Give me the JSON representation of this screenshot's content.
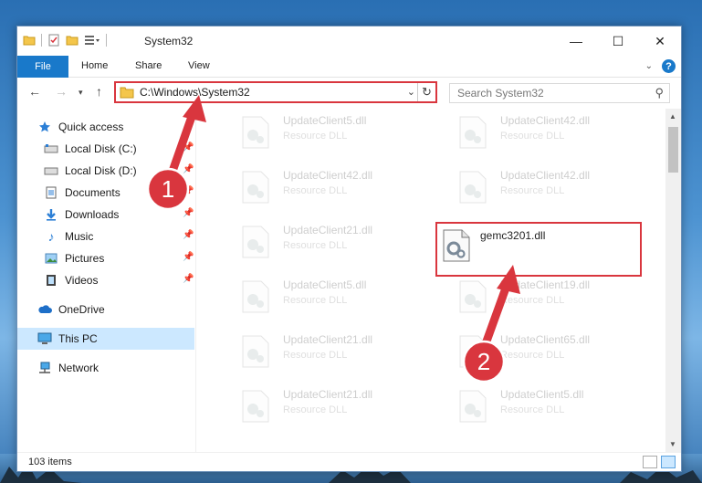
{
  "window": {
    "title": "System32",
    "minimize": "—",
    "maximize": "☐",
    "close": "✕"
  },
  "ribbon": {
    "file": "File",
    "tabs": [
      "Home",
      "Share",
      "View"
    ],
    "help": "?"
  },
  "address": {
    "path": "C:\\Windows\\System32",
    "search_placeholder": "Search System32"
  },
  "sidebar": {
    "items": [
      {
        "label": "Quick access",
        "icon": "star-icon"
      },
      {
        "label": "Local Disk (C:)",
        "icon": "drive-icon",
        "pinned": true
      },
      {
        "label": "Local Disk (D:)",
        "icon": "drive-icon",
        "pinned": true
      },
      {
        "label": "Documents",
        "icon": "documents-icon",
        "pinned": true
      },
      {
        "label": "Downloads",
        "icon": "downloads-icon",
        "pinned": true
      },
      {
        "label": "Music",
        "icon": "music-icon",
        "pinned": true
      },
      {
        "label": "Pictures",
        "icon": "pictures-icon",
        "pinned": true
      },
      {
        "label": "Videos",
        "icon": "videos-icon",
        "pinned": true
      },
      {
        "label": "OneDrive",
        "icon": "cloud-icon"
      },
      {
        "label": "This PC",
        "icon": "computer-icon",
        "selected": true
      },
      {
        "label": "Network",
        "icon": "network-icon"
      }
    ]
  },
  "files": {
    "left": [
      {
        "name": "UpdateClient5.dll",
        "type": "Resource DLL"
      },
      {
        "name": "UpdateClient42.dll",
        "type": "Resource DLL"
      },
      {
        "name": "UpdateClient21.dll",
        "type": "Resource DLL"
      },
      {
        "name": "UpdateClient5.dll",
        "type": "Resource DLL"
      },
      {
        "name": "UpdateClient21.dll",
        "type": "Resource DLL"
      },
      {
        "name": "UpdateClient21.dll",
        "type": "Resource DLL"
      }
    ],
    "right": [
      {
        "name": "UpdateClient42.dll",
        "type": "Resource DLL"
      },
      {
        "name": "UpdateClient42.dll",
        "type": "Resource DLL"
      },
      {
        "name": "gemc3201.dll",
        "type": ""
      },
      {
        "name": "UpdateClient19.dll",
        "type": "Resource DLL"
      },
      {
        "name": "UpdateClient65.dll",
        "type": "Resource DLL"
      },
      {
        "name": "UpdateClient5.dll",
        "type": "Resource DLL"
      }
    ]
  },
  "status": {
    "count": "103 items"
  },
  "annotations": {
    "step1": "1",
    "step2": "2",
    "color": "#d9363e"
  }
}
